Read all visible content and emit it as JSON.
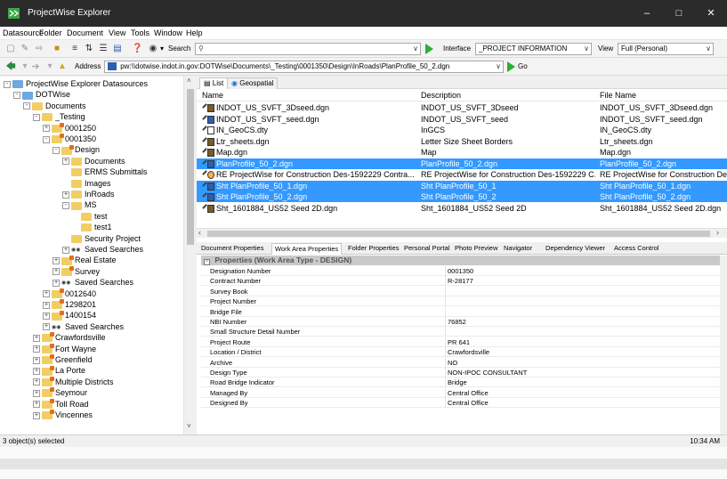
{
  "window": {
    "title": "ProjectWise Explorer",
    "controls": {
      "minimize": "–",
      "maximize": "□",
      "close": "✕"
    }
  },
  "menu": [
    "Datasource",
    "Folder",
    "Document",
    "View",
    "Tools",
    "Window",
    "Help"
  ],
  "toolbar1": {
    "search_label": "Search",
    "interface_label": "Interface",
    "interface_value": "_PROJECT INFORMATION",
    "view_label": "View",
    "view_value": "Full (Personal)"
  },
  "toolbar2": {
    "address_label": "Address",
    "address_value": "pw:\\\\dotwise.indot.in.gov:DOTWise\\Documents\\_Testing\\0001350\\Design\\InRoads\\PlanProfile_50_2.dgn",
    "go_label": "Go"
  },
  "tree": [
    {
      "label": "ProjectWise Explorer Datasources",
      "level": 0,
      "exp": "-",
      "icon": "datasource"
    },
    {
      "label": "DOTWise",
      "level": 1,
      "exp": "-",
      "icon": "datasource"
    },
    {
      "label": "Documents",
      "level": 2,
      "exp": "-",
      "icon": "folder"
    },
    {
      "label": "_Testing",
      "level": 3,
      "exp": "-",
      "icon": "folder"
    },
    {
      "label": "0001250",
      "level": 4,
      "exp": "+",
      "icon": "project"
    },
    {
      "label": "0001350",
      "level": 4,
      "exp": "-",
      "icon": "project"
    },
    {
      "label": "Design",
      "level": 5,
      "exp": "-",
      "icon": "project"
    },
    {
      "label": "Documents",
      "level": 6,
      "exp": "+",
      "icon": "folder"
    },
    {
      "label": "ERMS Submittals",
      "level": 6,
      "exp": "",
      "icon": "folder"
    },
    {
      "label": "Images",
      "level": 6,
      "exp": "",
      "icon": "folder"
    },
    {
      "label": "InRoads",
      "level": 6,
      "exp": "+",
      "icon": "folder"
    },
    {
      "label": "MS",
      "level": 6,
      "exp": "-",
      "icon": "folder"
    },
    {
      "label": "test",
      "level": 7,
      "exp": "",
      "icon": "folder"
    },
    {
      "label": "test1",
      "level": 7,
      "exp": "",
      "icon": "folder"
    },
    {
      "label": "Security Project",
      "level": 6,
      "exp": "",
      "icon": "folder"
    },
    {
      "label": "Saved Searches",
      "level": 6,
      "exp": "+",
      "icon": "search"
    },
    {
      "label": "Real Estate",
      "level": 5,
      "exp": "+",
      "icon": "project"
    },
    {
      "label": "Survey",
      "level": 5,
      "exp": "+",
      "icon": "project"
    },
    {
      "label": "Saved Searches",
      "level": 5,
      "exp": "+",
      "icon": "search"
    },
    {
      "label": "0012640",
      "level": 4,
      "exp": "+",
      "icon": "project"
    },
    {
      "label": "1298201",
      "level": 4,
      "exp": "+",
      "icon": "project"
    },
    {
      "label": "1400154",
      "level": 4,
      "exp": "+",
      "icon": "project"
    },
    {
      "label": "Saved Searches",
      "level": 4,
      "exp": "+",
      "icon": "search"
    },
    {
      "label": "Crawfordsville",
      "level": 3,
      "exp": "+",
      "icon": "project"
    },
    {
      "label": "Fort Wayne",
      "level": 3,
      "exp": "+",
      "icon": "project"
    },
    {
      "label": "Greenfield",
      "level": 3,
      "exp": "+",
      "icon": "project"
    },
    {
      "label": "La Porte",
      "level": 3,
      "exp": "+",
      "icon": "project"
    },
    {
      "label": "Multiple Districts",
      "level": 3,
      "exp": "+",
      "icon": "project"
    },
    {
      "label": "Seymour",
      "level": 3,
      "exp": "+",
      "icon": "project"
    },
    {
      "label": "Toll Road",
      "level": 3,
      "exp": "+",
      "icon": "project"
    },
    {
      "label": "Vincennes",
      "level": 3,
      "exp": "+",
      "icon": "project"
    }
  ],
  "view_tabs": [
    "List",
    "Geospatial"
  ],
  "list": {
    "headers": [
      "Name",
      "Description",
      "File Name"
    ],
    "rows": [
      {
        "name": "INDOT_US_SVFT_3Dseed.dgn",
        "desc": "INDOT_US_SVFT_3Dseed",
        "file": "INDOT_US_SVFT_3Dseed.dgn",
        "icon": "dgn",
        "selected": false
      },
      {
        "name": "INDOT_US_SVFT_seed.dgn",
        "desc": "INDOT_US_SVFT_seed",
        "file": "INDOT_US_SVFT_seed.dgn",
        "icon": "dgn-blue",
        "selected": false
      },
      {
        "name": "IN_GeoCS.dty",
        "desc": "InGCS",
        "file": "IN_GeoCS.dty",
        "icon": "page",
        "selected": false
      },
      {
        "name": "Ltr_sheets.dgn",
        "desc": "Letter Size Sheet Borders",
        "file": "Ltr_sheets.dgn",
        "icon": "dgn",
        "selected": false
      },
      {
        "name": "Map.dgn",
        "desc": "Map",
        "file": "Map.dgn",
        "icon": "dgn",
        "selected": false
      },
      {
        "name": "PlanProfile_50_2.dgn",
        "desc": "PlanProfile_50_2.dgn",
        "file": "PlanProfile_50_2.dgn",
        "icon": "dgn-blue",
        "selected": true
      },
      {
        "name": "RE  ProjectWise for Construction  Des-1592229  Contra...",
        "desc": "RE  ProjectWise for Construction  Des-1592229  C...",
        "file": "RE  ProjectWise for Construction  Des",
        "icon": "mail",
        "selected": false
      },
      {
        "name": "Sht PlanProfile_50_1.dgn",
        "desc": "Sht PlanProfile_50_1",
        "file": "Sht PlanProfile_50_1.dgn",
        "icon": "dgn-blue",
        "selected": true
      },
      {
        "name": "Sht PlanProfile_50_2.dgn",
        "desc": "Sht PlanProfile_50_2",
        "file": "Sht PlanProfile_50_2.dgn",
        "icon": "dgn-blue",
        "selected": true
      },
      {
        "name": "Sht_1601884_US52 Seed 2D.dgn",
        "desc": "Sht_1601884_US52 Seed 2D",
        "file": "Sht_1601884_US52 Seed 2D.dgn",
        "icon": "dgn",
        "selected": false
      }
    ]
  },
  "prop_tabs": [
    "Document Properties",
    "Work Area Properties",
    "Folder Properties",
    "Personal Portal",
    "Photo Preview",
    "Navigator",
    "Dependency Viewer",
    "Access Control"
  ],
  "prop_active_tab": 1,
  "properties": {
    "group": "Properties (Work Area Type - DESIGN)",
    "rows": [
      {
        "name": "Designation Number",
        "value": "0001350"
      },
      {
        "name": "Contract Number",
        "value": "R-28177"
      },
      {
        "name": "Survey Book",
        "value": ""
      },
      {
        "name": "Project Number",
        "value": ""
      },
      {
        "name": "Bridge File",
        "value": ""
      },
      {
        "name": "NBI Number",
        "value": "76852"
      },
      {
        "name": "Small Structure Detail Number",
        "value": ""
      },
      {
        "name": "Project Route",
        "value": "PR 641"
      },
      {
        "name": "Location / District",
        "value": "Crawfordsville"
      },
      {
        "name": "Archive",
        "value": "NO"
      },
      {
        "name": "Design Type",
        "value": "NON-IPOC CONSULTANT"
      },
      {
        "name": "Road Bridge Indicator",
        "value": "Bridge"
      },
      {
        "name": "Managed By",
        "value": "Central Office"
      },
      {
        "name": "Designed By",
        "value": "Central Office"
      }
    ]
  },
  "status": {
    "left": "3 object(s) selected",
    "right": "10:34 AM"
  },
  "colors": {
    "titlebar": "#2b2b2b",
    "selection": "#3399ff",
    "folder": "#f2cd64",
    "go_green": "#28b030"
  }
}
